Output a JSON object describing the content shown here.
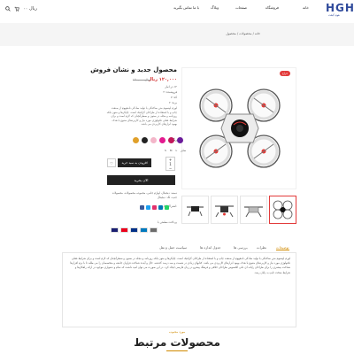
{
  "header": {
    "logo_text": "HGH",
    "logo_sub": "هوم گیفت",
    "nav": [
      "خانه",
      "فروشگاه",
      "صفحات",
      "وبلاگ",
      "با ما تماس بگیرید"
    ],
    "cart_amount": "۰۰ ریال"
  },
  "breadcrumb": {
    "text": "خانه  /  محصولات  /  محصول"
  },
  "product": {
    "title": "محصول جدید و نشان فروش",
    "price": "۱۲۰,۰۰۰ ریال",
    "old_price": "۱۵۰,۰۰۰ ریال",
    "sale_badge": "حراج",
    "meta": [
      "۱۲ در انبار",
      "فروشنده: ۲",
      "کد: ۷",
      "برند: ۲"
    ],
    "description": "لورم ایپسوم متن ساختگی با تولید سادگی نامفهوم از صنعت چاپ و با استفاده از طراحان گرافیک است. چاپگرها و متون بلکه روزنامه و مجله در ستون و سطرآنچنان که لازم است و برای شرایط فعلی تکنولوژی مورد نیاز و کاربردهای متنوع با هدف بهبود ابزارهای کاربردی می باشد.",
    "color_label": "رنگ",
    "colors": [
      "#e0a02a",
      "#222222",
      "#f3b6c9",
      "#e31a8f",
      "#c2185b",
      "#6a1b9a"
    ],
    "sizes": [
      "L",
      "M",
      "S",
      "XL"
    ],
    "size_label": "سایز",
    "qty": "1",
    "add_to_cart": "افزودن به سبد خرید",
    "buy_now": "الان بخرید",
    "categories": "دسته: دیجیتال، لوازم جانبی، مجموعه محصولات، محصولات جدید، تگ: دیجیتال",
    "share_label": "اشتراک گذاری:",
    "share_colors": [
      "#3b5998",
      "#1da1f2",
      "#e1306c",
      "#0077b5",
      "#25d366"
    ],
    "payment_label": "پرداخت مطمئن با",
    "payment_colors": [
      "#1a1f71",
      "#eb001b",
      "#003087",
      "#0079be",
      "#6c6c6c"
    ]
  },
  "tabs": {
    "items": [
      "توضیحات",
      "نظرات",
      "بررسی ها",
      "جدول اندازه ها",
      "سیاست حمل و نقل"
    ],
    "content": "لورم ایپسوم متن ساختگی با تولید سادگی نامفهوم از صنعت چاپ و با استفاده از طراحان گرافیک است. چاپگرها و متون بلکه روزنامه و مجله در ستون و سطرآنچنان که لازم است و برای شرایط فعلی تکنولوژی مورد نیاز و کاربردهای متنوع با هدف بهبود ابزارهای کاربردی می باشد. کتابهای زیادی در شصت و سه درصد گذشته، حال و آینده شناخت فراوان جامعه و متخصصان را می طلبد تا با نرم افزارها شناخت بیشتری را برای طراحان رایانه ای علی الخصوص طراحان خلاقی و فرهنگ پیشرو در زبان فارسی ایجاد کرد. در این صورت می توان امید داشت که تمام و دشواری موجود در ارائه راهکارها و شرایط سخت تایپ به پایان رسد."
  },
  "related": {
    "subtitle": "مورد محبوب",
    "title": "محصولات مرتبط"
  }
}
